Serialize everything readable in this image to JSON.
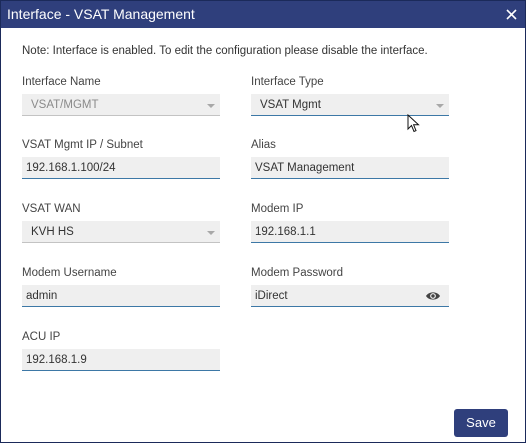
{
  "dialog": {
    "title": "Interface - VSAT Management",
    "note": "Note: Interface is enabled. To edit the configuration please disable the interface."
  },
  "fields": {
    "interface_name": {
      "label": "Interface Name",
      "value": "VSAT/MGMT"
    },
    "interface_type": {
      "label": "Interface Type",
      "value": "VSAT Mgmt"
    },
    "mgmt_ip": {
      "label": "VSAT Mgmt IP / Subnet",
      "value": "192.168.1.100/24"
    },
    "alias": {
      "label": "Alias",
      "value": "VSAT Management"
    },
    "vsat_wan": {
      "label": "VSAT WAN",
      "value": "KVH HS"
    },
    "modem_ip": {
      "label": "Modem IP",
      "value": "192.168.1.1"
    },
    "modem_username": {
      "label": "Modem Username",
      "value": "admin"
    },
    "modem_password": {
      "label": "Modem Password",
      "value": "iDirect"
    },
    "acu_ip": {
      "label": "ACU IP",
      "value": "192.168.1.9"
    }
  },
  "actions": {
    "save_label": "Save"
  },
  "icons": {
    "close": "close-icon",
    "password_toggle": "eye-icon",
    "dropdown": "chevron-down-icon"
  },
  "colors": {
    "title_bar": "#2f3f7c",
    "save_button": "#2f3f7c",
    "field_background": "#efefef",
    "focus_underline": "#3d78a6"
  }
}
